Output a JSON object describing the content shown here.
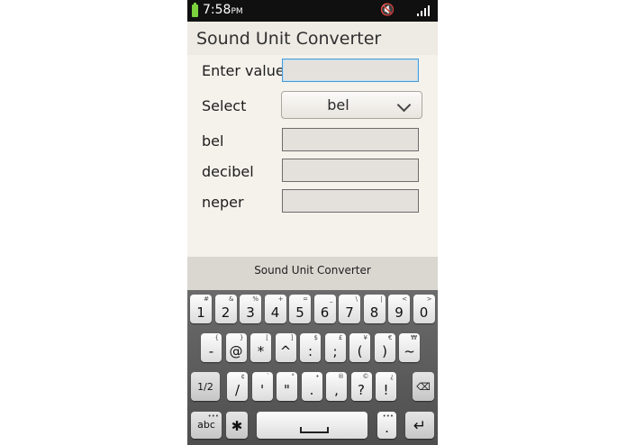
{
  "status_bar": {
    "time": "7:58",
    "ampm": "PM"
  },
  "app": {
    "title": "Sound Unit Converter"
  },
  "form": {
    "enter_value_label": "Enter value",
    "enter_value": "",
    "select_label": "Select",
    "select_value": "bel",
    "results": [
      {
        "label": "bel",
        "value": ""
      },
      {
        "label": "decibel",
        "value": ""
      },
      {
        "label": "neper",
        "value": ""
      }
    ]
  },
  "keyboard": {
    "header": "Sound Unit Converter",
    "row1": [
      {
        "main": "1",
        "sub": "#"
      },
      {
        "main": "2",
        "sub": "&"
      },
      {
        "main": "3",
        "sub": "%"
      },
      {
        "main": "4",
        "sub": "+"
      },
      {
        "main": "5",
        "sub": "="
      },
      {
        "main": "6",
        "sub": "_"
      },
      {
        "main": "7",
        "sub": "\\"
      },
      {
        "main": "8",
        "sub": "|"
      },
      {
        "main": "9",
        "sub": "<"
      },
      {
        "main": "0",
        "sub": ">"
      }
    ],
    "row2": [
      {
        "main": "-",
        "sub": "{"
      },
      {
        "main": "@",
        "sub": "}"
      },
      {
        "main": "*",
        "sub": "["
      },
      {
        "main": "^",
        "sub": "]"
      },
      {
        "main": ":",
        "sub": "$"
      },
      {
        "main": ";",
        "sub": "£"
      },
      {
        "main": "(",
        "sub": "¥"
      },
      {
        "main": ")",
        "sub": "€"
      },
      {
        "main": "~",
        "sub": "₩"
      }
    ],
    "row3": [
      {
        "main": "/",
        "sub": "¢"
      },
      {
        "main": "'",
        "sub": "`"
      },
      {
        "main": "\"",
        "sub": "°"
      },
      {
        "main": ".",
        "sub": "•"
      },
      {
        "main": ",",
        "sub": "®"
      },
      {
        "main": "?",
        "sub": "©"
      },
      {
        "main": "!",
        "sub": "¿"
      }
    ],
    "mode_label": "1/2",
    "abc_label": "abc"
  }
}
